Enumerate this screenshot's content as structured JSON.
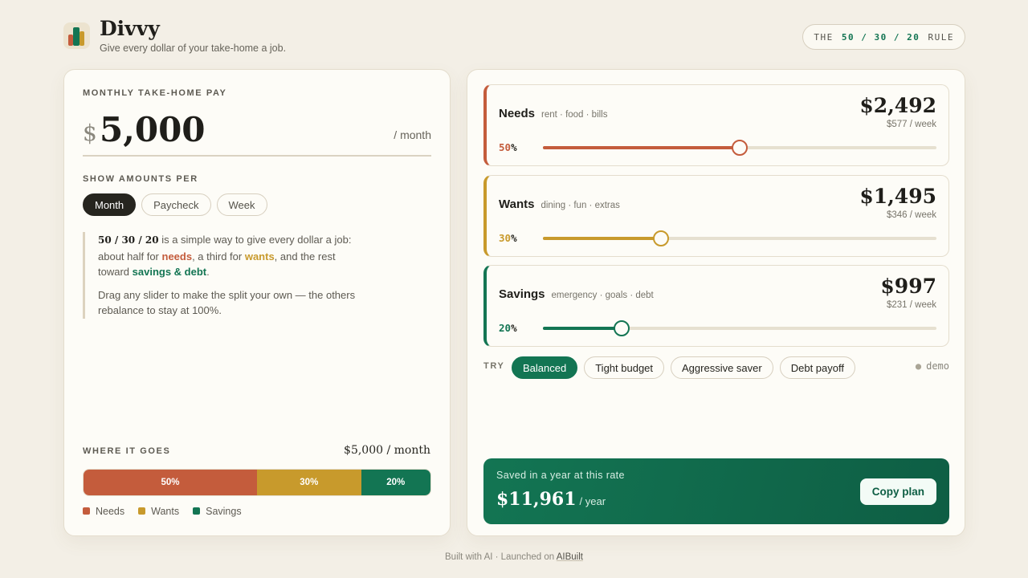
{
  "header": {
    "title": "Divvy",
    "subtitle": "Give every dollar of your take-home a job.",
    "rule_prefix": "THE",
    "rule_nums": "50 / 30 / 20",
    "rule_suffix": "RULE"
  },
  "pay": {
    "label": "MONTHLY TAKE-HOME PAY",
    "currency": "$",
    "amount": "5,000",
    "period": "/ month"
  },
  "show": {
    "label": "SHOW AMOUNTS PER",
    "options": [
      "Month",
      "Paycheck",
      "Week"
    ],
    "selected": "Month"
  },
  "note": {
    "rule": "50 / 30 / 20",
    "t1": " is a simple way to give every dollar a job: about half for ",
    "needs": "needs",
    "t2": ", a third for ",
    "wants": "wants",
    "t3": ", and the rest toward ",
    "savings": "savings & debt",
    "t4": ".",
    "p2": "Drag any slider to make the split your own — the others rebalance to stay at 100%."
  },
  "where": {
    "label": "WHERE IT GOES",
    "total": "$5,000 / month",
    "segments": [
      {
        "label": "50%",
        "value": 50,
        "color": "#c45c3c"
      },
      {
        "label": "30%",
        "value": 30,
        "color": "#c89a2c"
      },
      {
        "label": "20%",
        "value": 20,
        "color": "#137553"
      }
    ],
    "legend": [
      "Needs",
      "Wants",
      "Savings"
    ]
  },
  "categories": [
    {
      "name": "Needs",
      "desc": "rent · food · bills",
      "amount": "$2,492",
      "weekly": "$577 / week",
      "pct": "50",
      "value": 50,
      "color": "#c45c3c"
    },
    {
      "name": "Wants",
      "desc": "dining · fun · extras",
      "amount": "$1,495",
      "weekly": "$346 / week",
      "pct": "30",
      "value": 30,
      "color": "#c89a2c"
    },
    {
      "name": "Savings",
      "desc": "emergency · goals · debt",
      "amount": "$997",
      "weekly": "$231 / week",
      "pct": "20",
      "value": 20,
      "color": "#137553"
    }
  ],
  "percent_sign": "%",
  "try": {
    "label": "TRY",
    "presets": [
      "Balanced",
      "Tight budget",
      "Aggressive saver",
      "Debt payoff"
    ],
    "selected": "Balanced",
    "demo": "demo"
  },
  "saved": {
    "label": "Saved in a year at this rate",
    "value": "$11,961",
    "unit": "/ year",
    "button": "Copy plan"
  },
  "footer": {
    "text": "Built with AI · Launched on ",
    "link": "AIBuilt"
  }
}
